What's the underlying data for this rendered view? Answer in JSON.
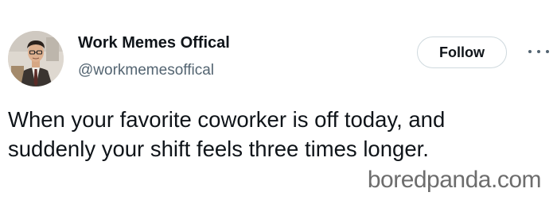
{
  "tweet": {
    "author": {
      "name": "Work Memes Offical",
      "handle": "@workmemesoffical",
      "avatar_icon": "avatar-photo-man-in-office"
    },
    "follow_label": "Follow",
    "more_icon": "more-dots-icon",
    "lines": [
      "When your favorite coworker is off today, and",
      "suddenly your shift feels three times longer."
    ]
  },
  "watermark": "boredpanda.com",
  "colors": {
    "text": "#0f1419",
    "secondary_text": "#536471",
    "button_border": "#cfd9de",
    "watermark": "#6d6d6d"
  }
}
